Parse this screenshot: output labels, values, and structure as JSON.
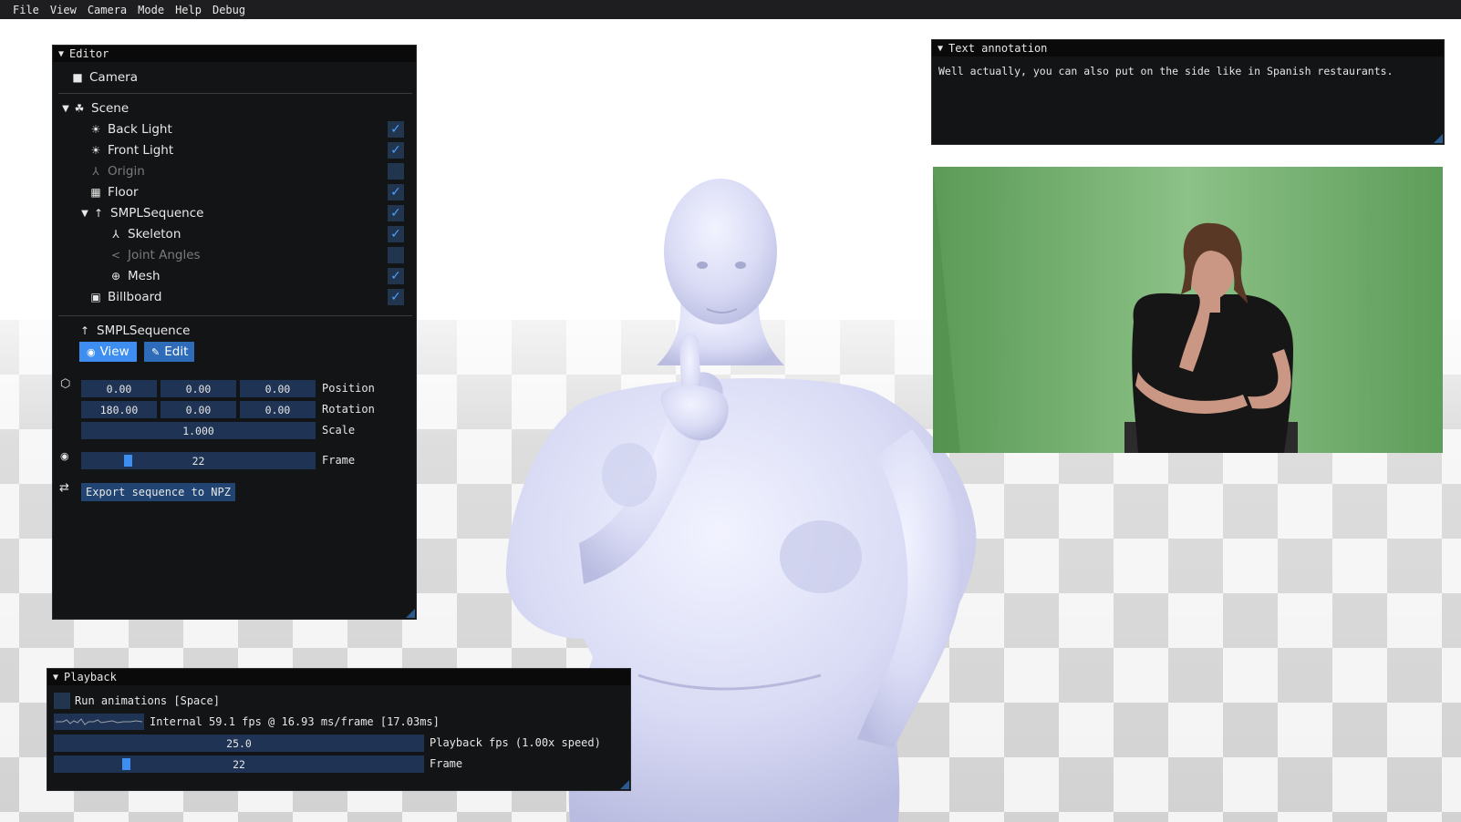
{
  "menu": [
    "File",
    "View",
    "Camera",
    "Mode",
    "Help",
    "Debug"
  ],
  "colors": {
    "accent": "#3d8ef0",
    "frame_bg": "#1f3454",
    "window_bg": "#131416",
    "greenscreen": "#6fa86a"
  },
  "editor": {
    "title": "Editor",
    "camera_label": "Camera",
    "tree": {
      "scene_label": "Scene",
      "items": [
        {
          "label": "Back Light",
          "icon": "light-icon",
          "checked": true
        },
        {
          "label": "Front Light",
          "icon": "light-icon",
          "checked": true
        },
        {
          "label": "Origin",
          "icon": "axes-icon",
          "checked": false
        },
        {
          "label": "Floor",
          "icon": "floor-icon",
          "checked": true
        },
        {
          "label": "SMPLSequence",
          "icon": "person-icon",
          "checked": true
        },
        {
          "label": "Skeleton",
          "icon": "skeleton-icon",
          "checked": true
        },
        {
          "label": "Joint Angles",
          "icon": "angle-icon",
          "checked": false
        },
        {
          "label": "Mesh",
          "icon": "mesh-icon",
          "checked": true
        },
        {
          "label": "Billboard",
          "icon": "image-icon",
          "checked": true
        }
      ]
    },
    "properties": {
      "node_title": "SMPLSequence",
      "view_button": "View",
      "edit_button": "Edit",
      "position": [
        "0.00",
        "0.00",
        "0.00"
      ],
      "position_label": "Position",
      "rotation": [
        "180.00",
        "0.00",
        "0.00"
      ],
      "rotation_label": "Rotation",
      "scale": "1.000",
      "scale_label": "Scale",
      "frame_value": "22",
      "frame_label": "Frame",
      "frame_fraction": 0.19,
      "export_button": "Export sequence to NPZ"
    }
  },
  "text_annotation": {
    "title": "Text annotation",
    "text": "Well actually, you can also put on the side like in Spanish restaurants."
  },
  "playback": {
    "title": "Playback",
    "run_label": "Run animations [Space]",
    "run_checked": false,
    "fps_text": "Internal 59.1 fps @ 16.93 ms/frame [17.03ms]",
    "playback_fps_value": "25.0",
    "playback_fps_label": "Playback fps  (1.00x speed)",
    "frame_value": "22",
    "frame_label": "Frame",
    "frame_fraction": 0.19
  }
}
